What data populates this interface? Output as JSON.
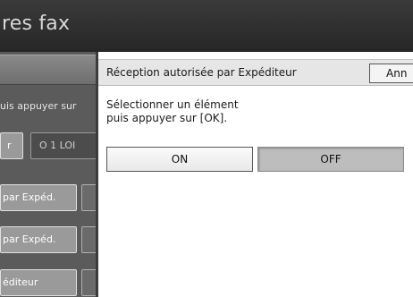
{
  "header": {
    "title": "res fax"
  },
  "background": {
    "instruction_fragment": "uis appuyer sur",
    "value_left_fragment": "r",
    "value_right_fragment": "O 1 LOI",
    "row1_label": "par Expéd.",
    "row2_label": "par Expéd.",
    "row3_label": "éditeur"
  },
  "dialog": {
    "title": "Réception autorisée par Expéditeur",
    "cancel_label": "Ann",
    "instruction_line1": "Sélectionner un élément",
    "instruction_line2": "puis appuyer sur [OK].",
    "options": {
      "on_label": "ON",
      "off_label": "OFF"
    },
    "selected": "OFF"
  },
  "colors": {
    "title_bar": "#2f2f2f",
    "dialog_bg": "#ffffff",
    "selected_option": "#bdbdbd"
  }
}
